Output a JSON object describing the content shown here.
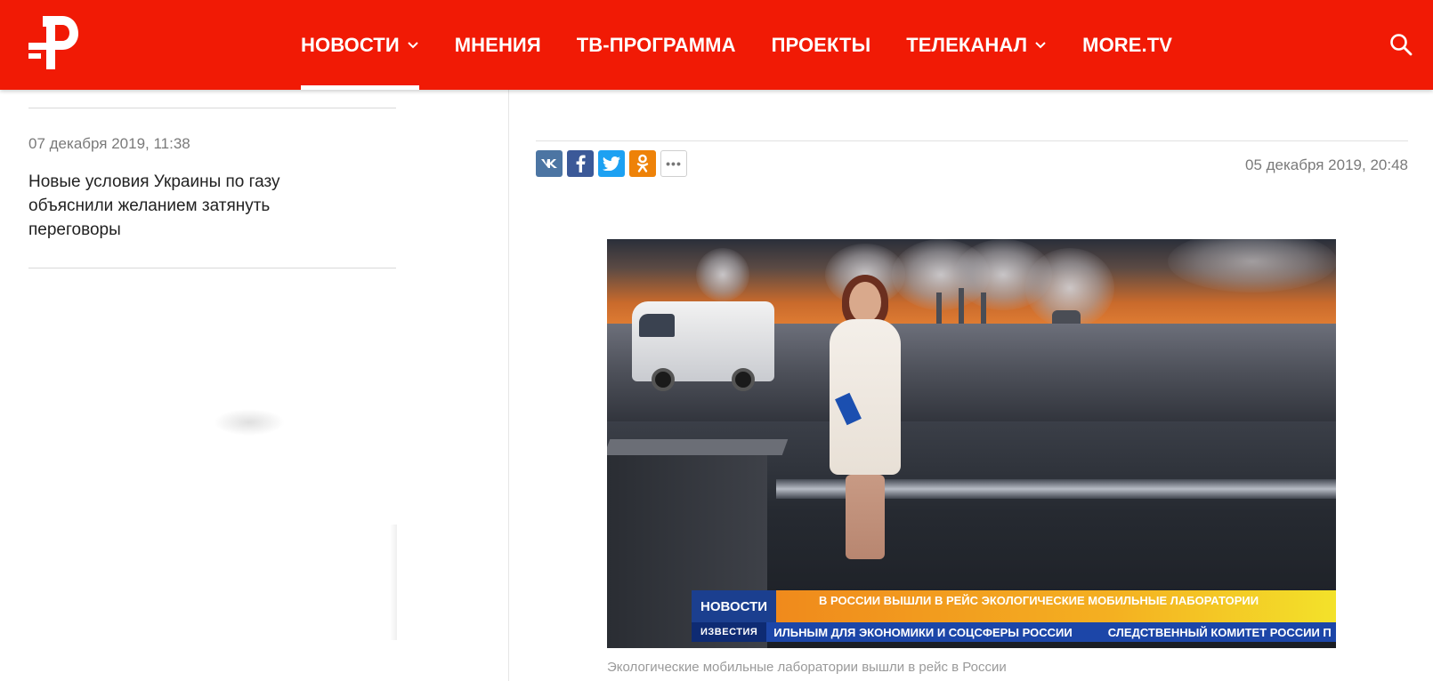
{
  "header": {
    "nav": [
      {
        "label": "НОВОСТИ",
        "dropdown": true,
        "active": true
      },
      {
        "label": "МНЕНИЯ",
        "dropdown": false,
        "active": false
      },
      {
        "label": "ТВ-ПРОГРАММА",
        "dropdown": false,
        "active": false
      },
      {
        "label": "ПРОЕКТЫ",
        "dropdown": false,
        "active": false
      },
      {
        "label": "ТЕЛЕКАНАЛ",
        "dropdown": true,
        "active": false
      },
      {
        "label": "MORE.TV",
        "dropdown": false,
        "active": false
      }
    ],
    "icons": {
      "logo": "ren-tv-logo",
      "search": "search-icon"
    },
    "colors": {
      "brand": "#f11a05",
      "text": "#ffffff"
    }
  },
  "sidebar": {
    "item": {
      "date": "07 декабря 2019, 11:38",
      "title": "Новые условия Украины по газу объяснили желанием затянуть переговоры"
    }
  },
  "article": {
    "date": "05 декабря 2019, 20:48",
    "share": [
      {
        "network": "vk",
        "icon": "vk-icon",
        "color": "#4c75a3"
      },
      {
        "network": "facebook",
        "icon": "facebook-icon",
        "color": "#3b5998"
      },
      {
        "network": "twitter",
        "icon": "twitter-icon",
        "color": "#1da1f2"
      },
      {
        "network": "odnoklassniki",
        "icon": "odnoklassniki-icon",
        "color": "#ee8208"
      },
      {
        "network": "more",
        "icon": "more-icon",
        "label": "•••"
      }
    ],
    "photo": {
      "caption": "Экологические мобильные лаборатории вышли в рейс в России",
      "lower_third": {
        "badge": "НОВОСТИ",
        "headline": "В РОССИИ ВЫШЛИ В РЕЙС ЭКОЛОГИЧЕСКИЕ МОБИЛЬНЫЕ ЛАБОРАТОРИИ",
        "ticker_brand": "ИЗВЕСТИЯ",
        "ticker_1": "ИЛЬНЫМ ДЛЯ ЭКОНОМИКИ И СОЦСФЕРЫ РОССИИ",
        "ticker_2": "СЛЕДСТВЕННЫЙ КОМИТЕТ РОССИИ П"
      }
    }
  }
}
